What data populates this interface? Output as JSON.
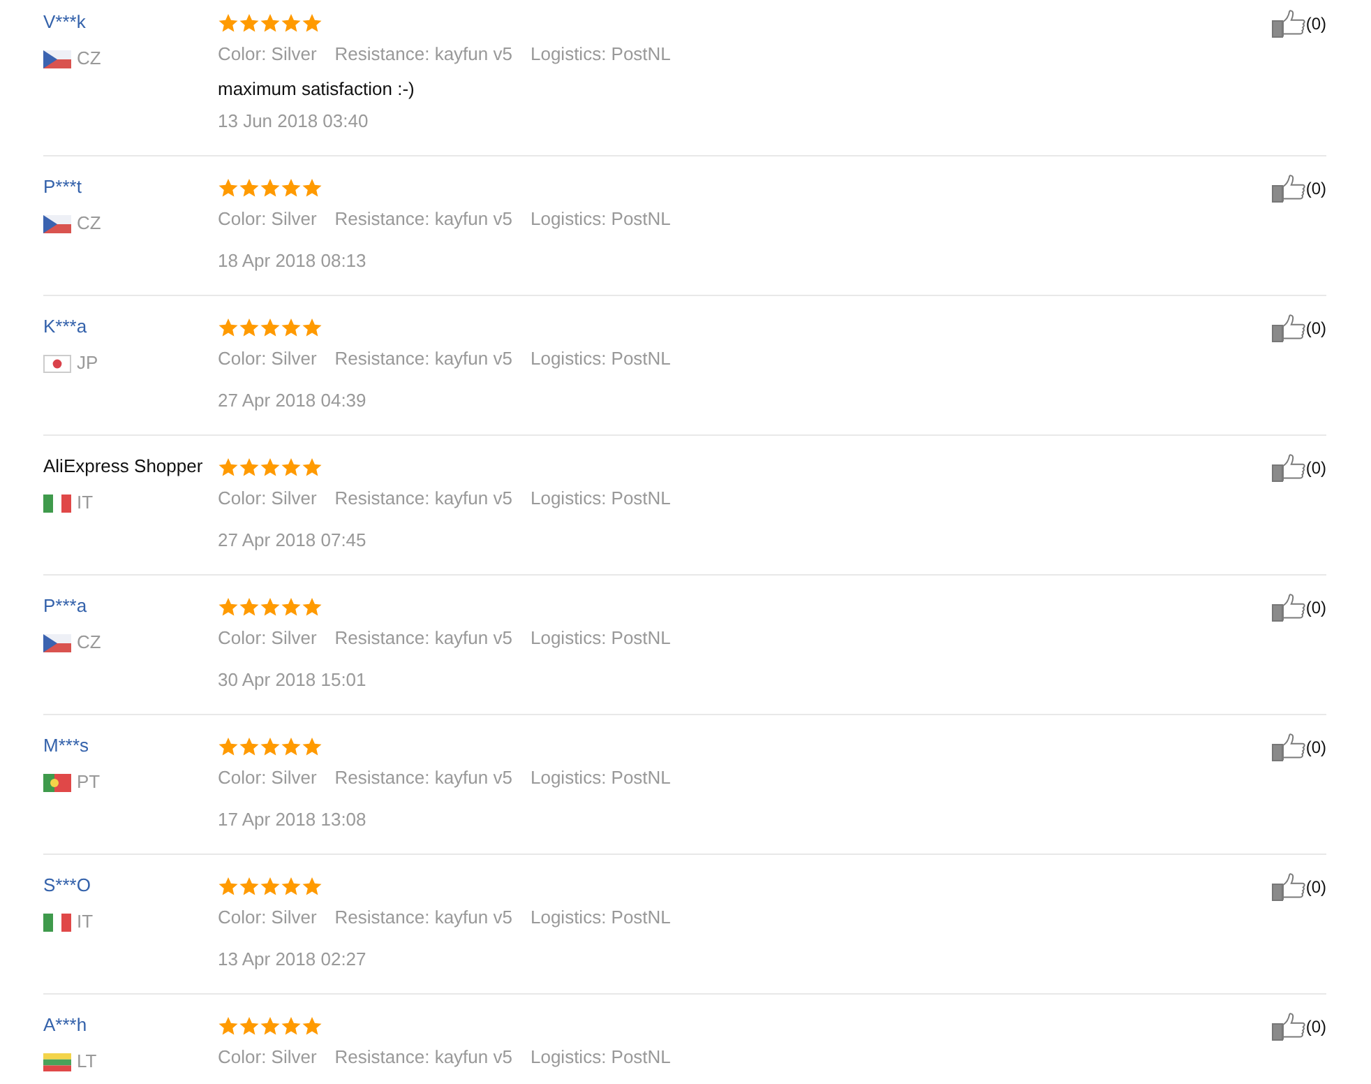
{
  "reviews": [
    {
      "name": "V***k",
      "name_linked": true,
      "flag": {
        "kind": "cz"
      },
      "country": "CZ",
      "stars": 5,
      "attributes": [
        "Color: Silver",
        "Resistance: kayfun v5",
        "Logistics: PostNL"
      ],
      "comment": "maximum satisfaction :-)",
      "date": "13 Jun 2018 03:40",
      "likes": "(0)"
    },
    {
      "name": "P***t",
      "name_linked": true,
      "flag": {
        "kind": "cz"
      },
      "country": "CZ",
      "stars": 5,
      "attributes": [
        "Color: Silver",
        "Resistance: kayfun v5",
        "Logistics: PostNL"
      ],
      "date": "18 Apr 2018 08:13",
      "likes": "(0)"
    },
    {
      "name": "K***a",
      "name_linked": true,
      "flag": {
        "kind": "jp"
      },
      "country": "JP",
      "stars": 5,
      "attributes": [
        "Color: Silver",
        "Resistance: kayfun v5",
        "Logistics: PostNL"
      ],
      "date": "27 Apr 2018 04:39",
      "likes": "(0)"
    },
    {
      "name": "AliExpress Shopper",
      "name_linked": false,
      "flag": {
        "kind": "it"
      },
      "country": "IT",
      "stars": 5,
      "attributes": [
        "Color: Silver",
        "Resistance: kayfun v5",
        "Logistics: PostNL"
      ],
      "date": "27 Apr 2018 07:45",
      "likes": "(0)"
    },
    {
      "name": "P***a",
      "name_linked": true,
      "flag": {
        "kind": "cz"
      },
      "country": "CZ",
      "stars": 5,
      "attributes": [
        "Color: Silver",
        "Resistance: kayfun v5",
        "Logistics: PostNL"
      ],
      "date": "30 Apr 2018 15:01",
      "likes": "(0)"
    },
    {
      "name": "M***s",
      "name_linked": true,
      "flag": {
        "kind": "pt"
      },
      "country": "PT",
      "stars": 5,
      "attributes": [
        "Color: Silver",
        "Resistance: kayfun v5",
        "Logistics: PostNL"
      ],
      "date": "17 Apr 2018 13:08",
      "likes": "(0)"
    },
    {
      "name": "S***O",
      "name_linked": true,
      "flag": {
        "kind": "it"
      },
      "country": "IT",
      "stars": 5,
      "attributes": [
        "Color: Silver",
        "Resistance: kayfun v5",
        "Logistics: PostNL"
      ],
      "date": "13 Apr 2018 02:27",
      "likes": "(0)"
    },
    {
      "name": "A***h",
      "name_linked": true,
      "flag": {
        "kind": "lt"
      },
      "country": "LT",
      "stars": 5,
      "attributes": [
        "Color: Silver",
        "Resistance: kayfun v5",
        "Logistics: PostNL"
      ],
      "likes": "(0)"
    }
  ]
}
